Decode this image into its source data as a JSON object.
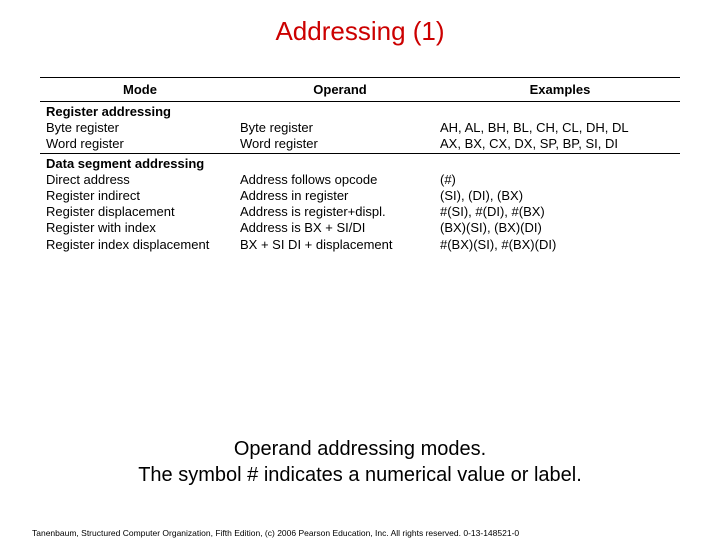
{
  "title": "Addressing (1)",
  "headers": {
    "mode": "Mode",
    "operand": "Operand",
    "examples": "Examples"
  },
  "section1": "Register addressing",
  "reg_rows": [
    {
      "mode": "Byte register",
      "operand": "Byte register",
      "examples": "AH, AL, BH, BL, CH, CL, DH, DL"
    },
    {
      "mode": "Word register",
      "operand": "Word register",
      "examples": "AX, BX, CX, DX, SP, BP, SI, DI"
    }
  ],
  "section2": "Data segment addressing",
  "data_rows": [
    {
      "mode": "Direct address",
      "operand": "Address follows opcode",
      "examples": "(#)"
    },
    {
      "mode": "Register indirect",
      "operand": "Address in register",
      "examples": "(SI), (DI), (BX)"
    },
    {
      "mode": "Register displacement",
      "operand": "Address is register+displ.",
      "examples": "#(SI), #(DI), #(BX)"
    },
    {
      "mode": "Register with index",
      "operand": "Address is BX + SI/DI",
      "examples": "(BX)(SI), (BX)(DI)"
    },
    {
      "mode": "Register index displacement",
      "operand": "BX + SI DI + displacement",
      "examples": "#(BX)(SI), #(BX)(DI)"
    }
  ],
  "caption": {
    "line1": "Operand addressing modes.",
    "line2": "The symbol # indicates a numerical value or label."
  },
  "footer": "Tanenbaum, Structured Computer Organization, Fifth Edition, (c) 2006 Pearson Education, Inc. All rights reserved. 0-13-148521-0"
}
